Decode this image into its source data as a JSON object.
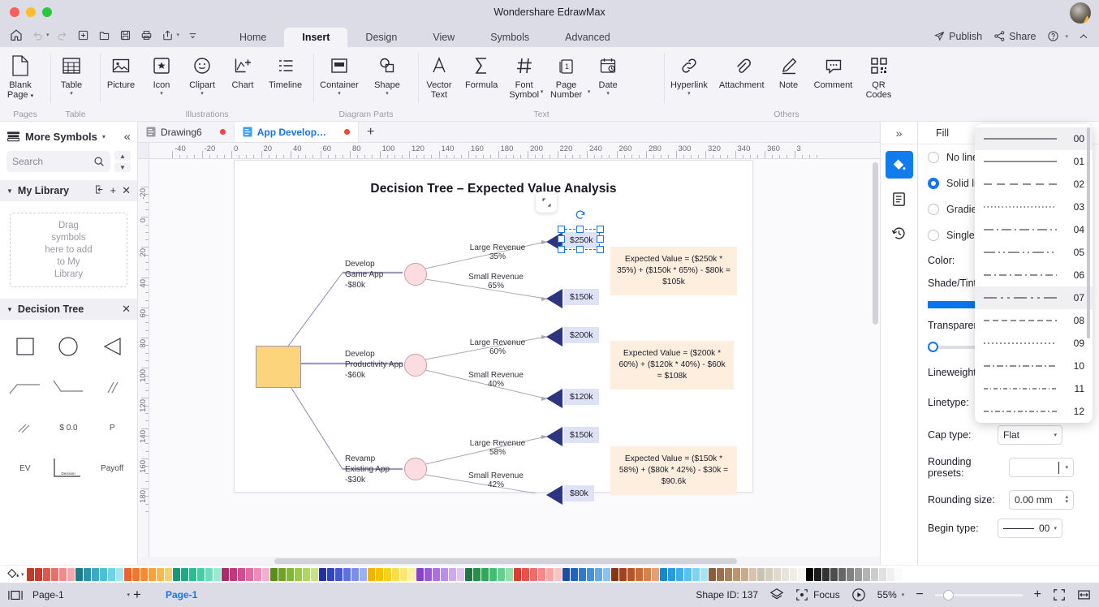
{
  "window": {
    "title": "Wondershare EdrawMax"
  },
  "menu": {
    "tabs": [
      "Home",
      "Insert",
      "Design",
      "View",
      "Symbols",
      "Advanced"
    ],
    "active": "Insert",
    "right": {
      "publish": "Publish",
      "share": "Share"
    }
  },
  "ribbon": {
    "groups": [
      {
        "label": "Pages",
        "items": [
          {
            "label": "Blank\nPage",
            "icon": "blank-page-icon",
            "caret": true
          }
        ]
      },
      {
        "label": "Table",
        "items": [
          {
            "label": "Table",
            "icon": "table-icon",
            "caret": true
          }
        ]
      },
      {
        "label": "Illustrations",
        "items": [
          {
            "label": "Picture",
            "icon": "picture-icon",
            "caret": false
          },
          {
            "label": "Icon",
            "icon": "icon-icon",
            "caret": true
          },
          {
            "label": "Clipart",
            "icon": "clipart-icon",
            "caret": true
          },
          {
            "label": "Chart",
            "icon": "chart-icon",
            "caret": false
          },
          {
            "label": "Timeline",
            "icon": "timeline-icon",
            "caret": false
          }
        ]
      },
      {
        "label": "Diagram Parts",
        "items": [
          {
            "label": "Container",
            "icon": "container-icon",
            "caret": true
          },
          {
            "label": "Shape",
            "icon": "shape-icon",
            "caret": true
          }
        ]
      },
      {
        "label": "Text",
        "items": [
          {
            "label": "Vector\nText",
            "icon": "vector-text-icon",
            "caret": false
          },
          {
            "label": "Formula",
            "icon": "formula-icon",
            "caret": false
          },
          {
            "label": "Font\nSymbol",
            "icon": "font-symbol-icon",
            "caret": true
          },
          {
            "label": "Page\nNumber",
            "icon": "page-number-icon",
            "caret": true
          },
          {
            "label": "Date",
            "icon": "date-icon",
            "caret": true
          }
        ]
      },
      {
        "label": "Others",
        "items": [
          {
            "label": "Hyperlink",
            "icon": "hyperlink-icon",
            "caret": true
          },
          {
            "label": "Attachment",
            "icon": "attachment-icon",
            "caret": false
          },
          {
            "label": "Note",
            "icon": "note-icon",
            "caret": false
          },
          {
            "label": "Comment",
            "icon": "comment-icon",
            "caret": false
          },
          {
            "label": "QR\nCodes",
            "icon": "qr-codes-icon",
            "caret": false
          }
        ]
      }
    ]
  },
  "left_panel": {
    "title": "More Symbols",
    "search_placeholder": "Search",
    "sections": [
      {
        "name": "My Library",
        "drop_hint": "Drag\nsymbols\nhere to add\nto My\nLibrary"
      },
      {
        "name": "Decision Tree",
        "symbols": [
          "square",
          "circle",
          "triangle",
          "elbow-line",
          "step-line",
          "double-slash",
          "double-slash-small",
          "$ 0.0",
          "P",
          "EV",
          "decision-bracket",
          "Payoff"
        ]
      }
    ]
  },
  "doc_tabs": {
    "tabs": [
      {
        "label": "Drawing6",
        "modified": true,
        "active": false
      },
      {
        "label": "App Develop…",
        "modified": true,
        "active": true
      }
    ],
    "add_label": "+"
  },
  "rulers": {
    "horizontal": [
      "-40",
      "-20",
      "0",
      "20",
      "40",
      "60",
      "80",
      "100",
      "120",
      "140",
      "160",
      "180",
      "200",
      "220",
      "240",
      "260",
      "280",
      "300",
      "320",
      "340",
      "360",
      "3"
    ],
    "vertical": [
      "-20",
      "0",
      "20",
      "40",
      "60",
      "80",
      "100",
      "120",
      "140",
      "160",
      "180"
    ]
  },
  "chart_data": {
    "type": "diagram",
    "title": "Decision Tree – Expected Value Analysis",
    "root": {
      "label": "",
      "fill": "#fcd47c"
    },
    "branches": [
      {
        "decision": "Develop\nGame App",
        "cost": "-$80k",
        "outcomes": [
          {
            "label": "Large Revenue",
            "prob": "35%",
            "payoff": "$250k",
            "selected": true
          },
          {
            "label": "Small Revenue",
            "prob": "65%",
            "payoff": "$150k",
            "selected": false
          }
        ],
        "callout": "Expected Value = ($250k * 35%) + ($150k * 65%) - $80k = $105k"
      },
      {
        "decision": "Develop\nProductivity App",
        "cost": "-$60k",
        "outcomes": [
          {
            "label": "Large Revenue",
            "prob": "60%",
            "payoff": "$200k",
            "selected": false
          },
          {
            "label": "Small Revenue",
            "prob": "40%",
            "payoff": "$120k",
            "selected": false
          }
        ],
        "callout": "Expected Value = ($200k * 60%) + ($120k * 40%) - $60k = $108k"
      },
      {
        "decision": "Revamp\nExisting App",
        "cost": "-$30k",
        "outcomes": [
          {
            "label": "Large Revenue",
            "prob": "58%",
            "payoff": "$150k",
            "selected": false
          },
          {
            "label": "Small Revenue",
            "prob": "42%",
            "payoff": "$80k",
            "selected": false
          }
        ],
        "callout": "Expected Value = ($150k * 58%) + ($80k * 42%) - $30k = $90.6k"
      }
    ]
  },
  "right_panel": {
    "header": "Fill",
    "fill_options": [
      {
        "label": "No line",
        "selected": false
      },
      {
        "label": "Solid li",
        "selected": true
      },
      {
        "label": "Gradie",
        "selected": false
      },
      {
        "label": "Single",
        "selected": false
      }
    ],
    "color_label": "Color:",
    "shade_label": "Shade/Tint",
    "shade_color": "#0b74f0",
    "transparency_label": "Transparen",
    "lineweight_label": "Lineweight",
    "linetype_label": "Linetype:",
    "linetype_value": "00",
    "cap_type_label": "Cap type:",
    "cap_type_value": "Flat",
    "rounding_presets_label": "Rounding presets:",
    "rounding_presets_value": "",
    "rounding_size_label": "Rounding size:",
    "rounding_size_value": "0.00 mm",
    "begin_type_label": "Begin type:",
    "begin_type_value": "00",
    "linetype_dropdown": {
      "items": [
        "00",
        "01",
        "02",
        "03",
        "04",
        "05",
        "06",
        "07",
        "08",
        "09",
        "10",
        "11",
        "12"
      ],
      "highlighted": [
        "00",
        "07"
      ]
    }
  },
  "palette": {
    "colors": [
      "#c0392b",
      "#d7352c",
      "#e2574c",
      "#ea6f6a",
      "#ef8b8b",
      "#f2a8ad",
      "#1f7a8c",
      "#2e92a8",
      "#3fa9c4",
      "#54bdd6",
      "#74d1e3",
      "#a8e4ef",
      "#ef6033",
      "#f3762f",
      "#f68b2c",
      "#f9a233",
      "#fbb845",
      "#fccd6b",
      "#0f9b78",
      "#1aac84",
      "#29bd94",
      "#45cda6",
      "#6ddcbb",
      "#9ce9d2",
      "#a82d6b",
      "#bd3b7d",
      "#cf4e91",
      "#e06aa6",
      "#ec8cbb",
      "#f3aed0",
      "#5c8b1f",
      "#6fa226",
      "#82b830",
      "#96cc3f",
      "#aed956",
      "#c6e47f",
      "#1f2fa8",
      "#2f45c0",
      "#4158d1",
      "#5b73de",
      "#7a8fe8",
      "#9fb0f1",
      "#f0b400",
      "#f5c200",
      "#f8d024",
      "#fadc4c",
      "#fce678",
      "#fdefa4",
      "#8b3fd1",
      "#9c57da",
      "#ad70e2",
      "#bf8bea",
      "#d0a7f1",
      "#e2c4f7",
      "#1d7a3e",
      "#25914b",
      "#2fa85a",
      "#44bd70",
      "#68cf8c",
      "#93e0ab",
      "#e03b2e",
      "#e9534a",
      "#ef6d68",
      "#f48b89",
      "#f8a7a7",
      "#fbc3c4",
      "#1a4fa0",
      "#2464b8",
      "#2f7ad0",
      "#4391de",
      "#63a9e8",
      "#8cc2f1",
      "#8a3416",
      "#9e431d",
      "#b35527",
      "#c76a38",
      "#d5824f",
      "#e0a07a",
      "#1a87c9",
      "#2a9ada",
      "#3fade6",
      "#5bc0ee",
      "#7ed2f4",
      "#a8e2f8",
      "#8a5d3b",
      "#9c6e49",
      "#ad8059",
      "#be936e",
      "#cda88b",
      "#dcc0aa",
      "#c9c1b2",
      "#d4cdc0",
      "#dfd9cf",
      "#e8e4dc",
      "#f0ede7",
      "#f6f4f1",
      "#000000",
      "#1c1c1c",
      "#333333",
      "#4d4d4d",
      "#666666",
      "#808080",
      "#999999",
      "#b3b3b3",
      "#cccccc",
      "#e0e0e0",
      "#f0f0f0",
      "#fafafa"
    ]
  },
  "status": {
    "page_select": "Page-1",
    "add_page": "+",
    "current_page": "Page-1",
    "shape_id": "Shape ID: 137",
    "focus": "Focus",
    "zoom": "55%"
  }
}
